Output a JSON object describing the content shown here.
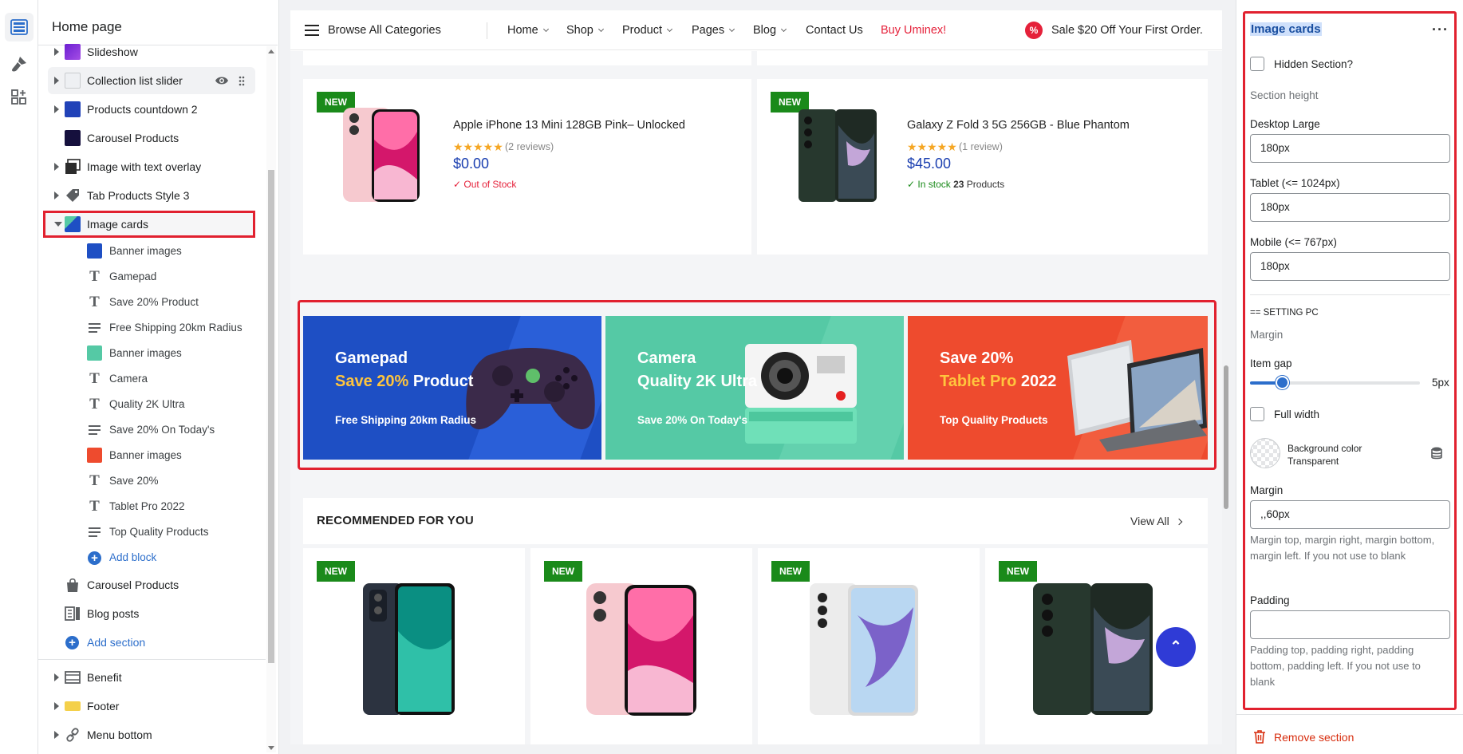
{
  "sidebar": {
    "title": "Home page",
    "items": [
      {
        "label": "Slideshow"
      },
      {
        "label": "Collection list slider"
      },
      {
        "label": "Products countdown 2"
      },
      {
        "label": "Carousel Products"
      },
      {
        "label": "Image with text overlay"
      },
      {
        "label": "Tab Products Style 3"
      },
      {
        "label": "Image cards"
      }
    ],
    "blocks": [
      {
        "label": "Banner images"
      },
      {
        "label": "Gamepad"
      },
      {
        "label": "Save 20% Product"
      },
      {
        "label": "Free Shipping 20km Radius"
      },
      {
        "label": "Banner images"
      },
      {
        "label": "Camera"
      },
      {
        "label": "Quality 2K Ultra"
      },
      {
        "label": "Save 20% On Today's"
      },
      {
        "label": "Banner images"
      },
      {
        "label": "Save 20%"
      },
      {
        "label": "Tablet Pro 2022"
      },
      {
        "label": "Top Quality Products"
      }
    ],
    "add_block": "Add block",
    "after_items": [
      {
        "label": "Carousel Products"
      },
      {
        "label": "Blog posts"
      }
    ],
    "add_section": "Add section",
    "footer_items": [
      {
        "label": "Benefit"
      },
      {
        "label": "Footer"
      },
      {
        "label": "Menu bottom"
      }
    ]
  },
  "store": {
    "nav": {
      "browse": "Browse All Categories",
      "items": [
        "Home",
        "Shop",
        "Product",
        "Pages",
        "Blog"
      ],
      "contact": "Contact Us",
      "buy": "Buy Uminex!",
      "sale": "Sale $20 Off Your First Order."
    },
    "products_top": [
      {
        "badge": "NEW",
        "title": "Apple iPhone 13 Mini 128GB Pink– Unlocked",
        "stars": "★★★★★",
        "reviews": "(2 reviews)",
        "price": "$0.00",
        "stock": "Out of Stock"
      },
      {
        "badge": "NEW",
        "title": "Galaxy Z Fold 3 5G 256GB - Blue Phantom",
        "stars": "★★★★★",
        "reviews": "(1 review)",
        "price": "$45.00",
        "stock": "In stock",
        "stock_count": "23",
        "stock_unit": "Products"
      }
    ],
    "banners": [
      {
        "line1": "Gamepad",
        "line2_hl": "Save 20%",
        "line2_rest": " Product",
        "line3": "Free Shipping 20km Radius",
        "color": "#1e4fc4"
      },
      {
        "line1": "Camera",
        "line2_hl": "",
        "line2_rest": "Quality 2K Ultra",
        "line3": "Save 20% On Today's",
        "color": "#55c9a5"
      },
      {
        "line1": "Save 20%",
        "line2_hl": "Tablet Pro",
        "line2_rest": " 2022",
        "line3": "Top Quality Products",
        "color": "#ee4b2e"
      }
    ],
    "recommended": {
      "heading": "RECOMMENDED FOR YOU",
      "view_all": "View All",
      "badges": [
        "NEW",
        "NEW",
        "NEW",
        "NEW"
      ]
    }
  },
  "settings": {
    "title": "Image cards",
    "hidden_section": "Hidden Section?",
    "section_height": "Section height",
    "desktop_large": {
      "label": "Desktop Large",
      "value": "180px"
    },
    "tablet": {
      "label": "Tablet (<= 1024px)",
      "value": "180px"
    },
    "mobile": {
      "label": "Mobile (<= 767px)",
      "value": "180px"
    },
    "setting_pc": "== SETTING PC",
    "margin_heading": "Margin",
    "item_gap": {
      "label": "Item gap",
      "value": "5px",
      "level": 0.19
    },
    "full_width": "Full width",
    "bg_color": {
      "label": "Background color",
      "value": "Transparent"
    },
    "margin": {
      "label": "Margin",
      "value": ",,60px",
      "help": "Margin top, margin right, margin bottom, margin left. If you not use to blank"
    },
    "padding": {
      "label": "Padding",
      "value": "",
      "help": "Padding top, padding right, padding bottom, padding left. If you not use to blank"
    },
    "remove": "Remove section"
  },
  "colors": {
    "accent": "#2c6ecb",
    "highlight_red": "#e1212f",
    "badge_green": "#1a8a1a",
    "price_blue": "#1b3fb0"
  }
}
